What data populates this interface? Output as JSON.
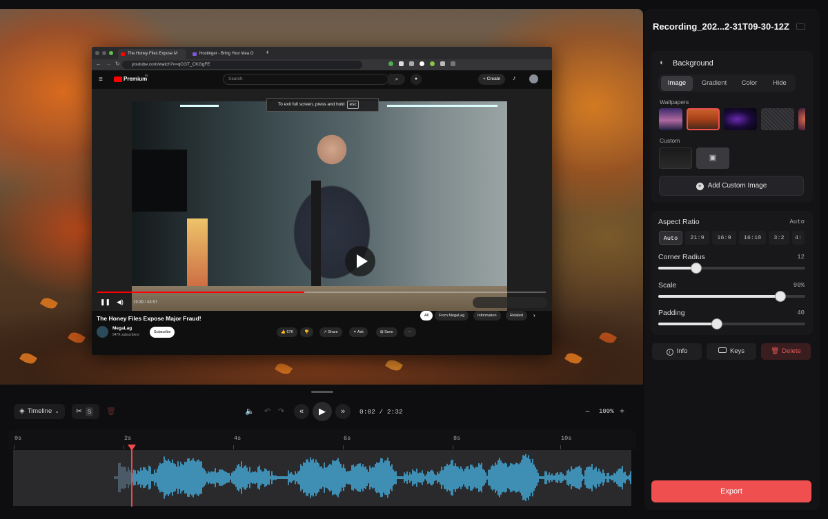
{
  "panel": {
    "title": "Recording_202...2-31T09-30-12Z",
    "background_label": "Background",
    "bg_tabs": [
      "Image",
      "Gradient",
      "Color",
      "Hide"
    ],
    "active_bg_tab": "Image",
    "wallpapers_label": "Wallpapers",
    "custom_label": "Custom",
    "add_custom_label": "Add Custom Image",
    "aspect_ratio_label": "Aspect Ratio",
    "aspect_ratio_value": "Auto",
    "aspect_options": [
      "Auto",
      "21:9",
      "16:9",
      "16:10",
      "3:2",
      "4:"
    ],
    "active_aspect": "Auto",
    "corner_radius_label": "Corner Radius",
    "corner_radius_value": "12",
    "corner_radius_level": 0.26,
    "scale_label": "Scale",
    "scale_value": "90%",
    "scale_level": 0.83,
    "padding_label": "Padding",
    "padding_value": "40",
    "padding_level": 0.4,
    "info_label": "Info",
    "keys_label": "Keys",
    "delete_label": "Delete",
    "export_label": "Export",
    "accent": "#ef4f4f"
  },
  "browser": {
    "tab1": "The Honey Files Expose M",
    "tab2": "Hostinger - Bring Your Idea O",
    "url": "youtube.com/watch?v=qCGT_CKGgFE",
    "search_placeholder": "Search",
    "brand": "Premium",
    "brand_sup": "IN",
    "create_label": "Create",
    "toast_text": "To exit full screen, press and hold",
    "toast_key": "esc",
    "time": "19:39 / 43:57",
    "video_title": "The Honey Files Expose Major Fraud!",
    "channel": "MegaLag",
    "subscribers": "947K subscribers",
    "subscribe_label": "Subscribe",
    "likes": "67K",
    "share_label": "Share",
    "ask_label": "Ask",
    "save_label": "Save",
    "chips": [
      "All",
      "From MegaLag",
      "Information",
      "Related"
    ]
  },
  "timeline": {
    "mode_label": "Timeline",
    "split_key": "S",
    "time_display": "0:02 / 2:32",
    "zoom": "100%",
    "ticks": [
      "0s",
      "2s",
      "4s",
      "6s",
      "8s",
      "10s"
    ]
  }
}
